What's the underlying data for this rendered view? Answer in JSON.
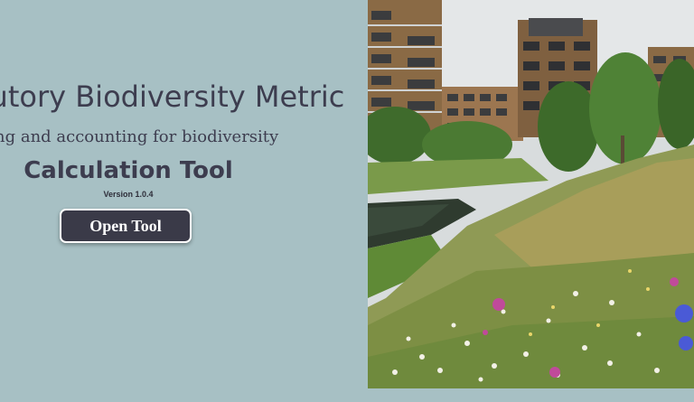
{
  "hero": {
    "title": "tutory Biodiversity Metric",
    "subtitle": "ng and accounting for biodiversity",
    "tool_name": "Calculation Tool",
    "version": "Version 1.0.4",
    "open_button_label": "Open Tool"
  },
  "colors": {
    "panel_background": "#a7c0c4",
    "text": "#3d3d4f",
    "button_background": "#3a3a48",
    "button_text": "#ffffff"
  },
  "photo": {
    "subject": "wildflower-meadow-with-river-and-apartment-buildings"
  }
}
